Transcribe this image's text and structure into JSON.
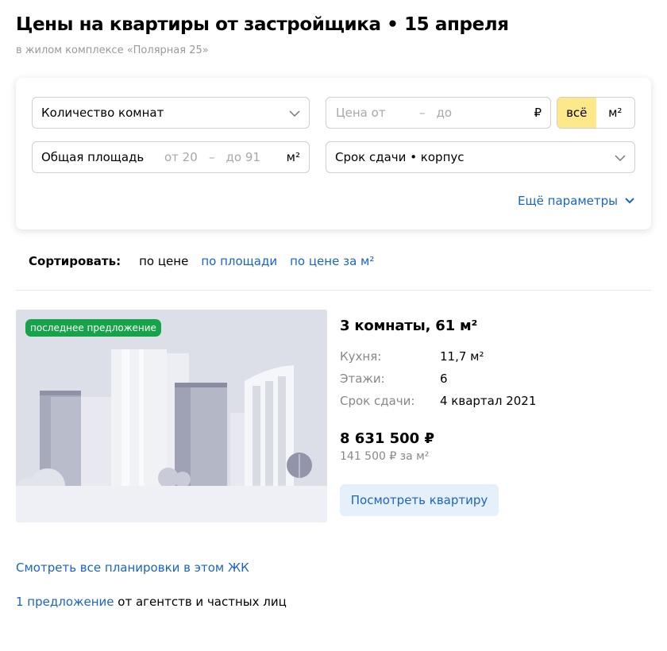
{
  "header": {
    "title": "Цены на квартиры от застройщика • 15 апреля",
    "subtitle": "в жилом комплексе «Полярная 25»"
  },
  "filters": {
    "rooms": {
      "label": "Количество комнат",
      "icon": "chevron-down-icon"
    },
    "price": {
      "from_placeholder": "Цена от",
      "separator": "–",
      "to_placeholder": "до",
      "currency": "₽"
    },
    "price_mode": {
      "options": [
        "всё",
        "м²"
      ],
      "selected": "всё"
    },
    "area": {
      "label": "Общая площадь",
      "from_placeholder": "от 20",
      "separator": "–",
      "to_placeholder": "до 91",
      "unit": "м²"
    },
    "deadline": {
      "label": "Срок сдачи • корпус",
      "icon": "chevron-down-icon"
    },
    "more_label": "Ещё параметры"
  },
  "sort": {
    "label": "Сортировать:",
    "options": [
      "по цене",
      "по площади",
      "по цене за м²"
    ],
    "selected": "по цене"
  },
  "card": {
    "badge": "последнее предложение",
    "title": "3 комнаты, 61 м²",
    "specs": [
      {
        "key": "Кухня:",
        "value": "11,7 м²"
      },
      {
        "key": "Этажи:",
        "value": "6"
      },
      {
        "key": "Срок сдачи:",
        "value": "4 квартал 2021"
      }
    ],
    "price": "8 631 500 ₽",
    "price_per_m2": "141 500 ₽ за м²",
    "button": "Посмотреть квартиру"
  },
  "links": {
    "all_plans": "Смотреть все планировки в этом ЖК",
    "offers_link": "1 предложение",
    "offers_rest": " от агентств и частных лиц"
  },
  "colors": {
    "link": "#1a64c8",
    "badge": "#16a34a",
    "active_toggle": "#fde98a",
    "button_bg": "#e6f0fb"
  }
}
